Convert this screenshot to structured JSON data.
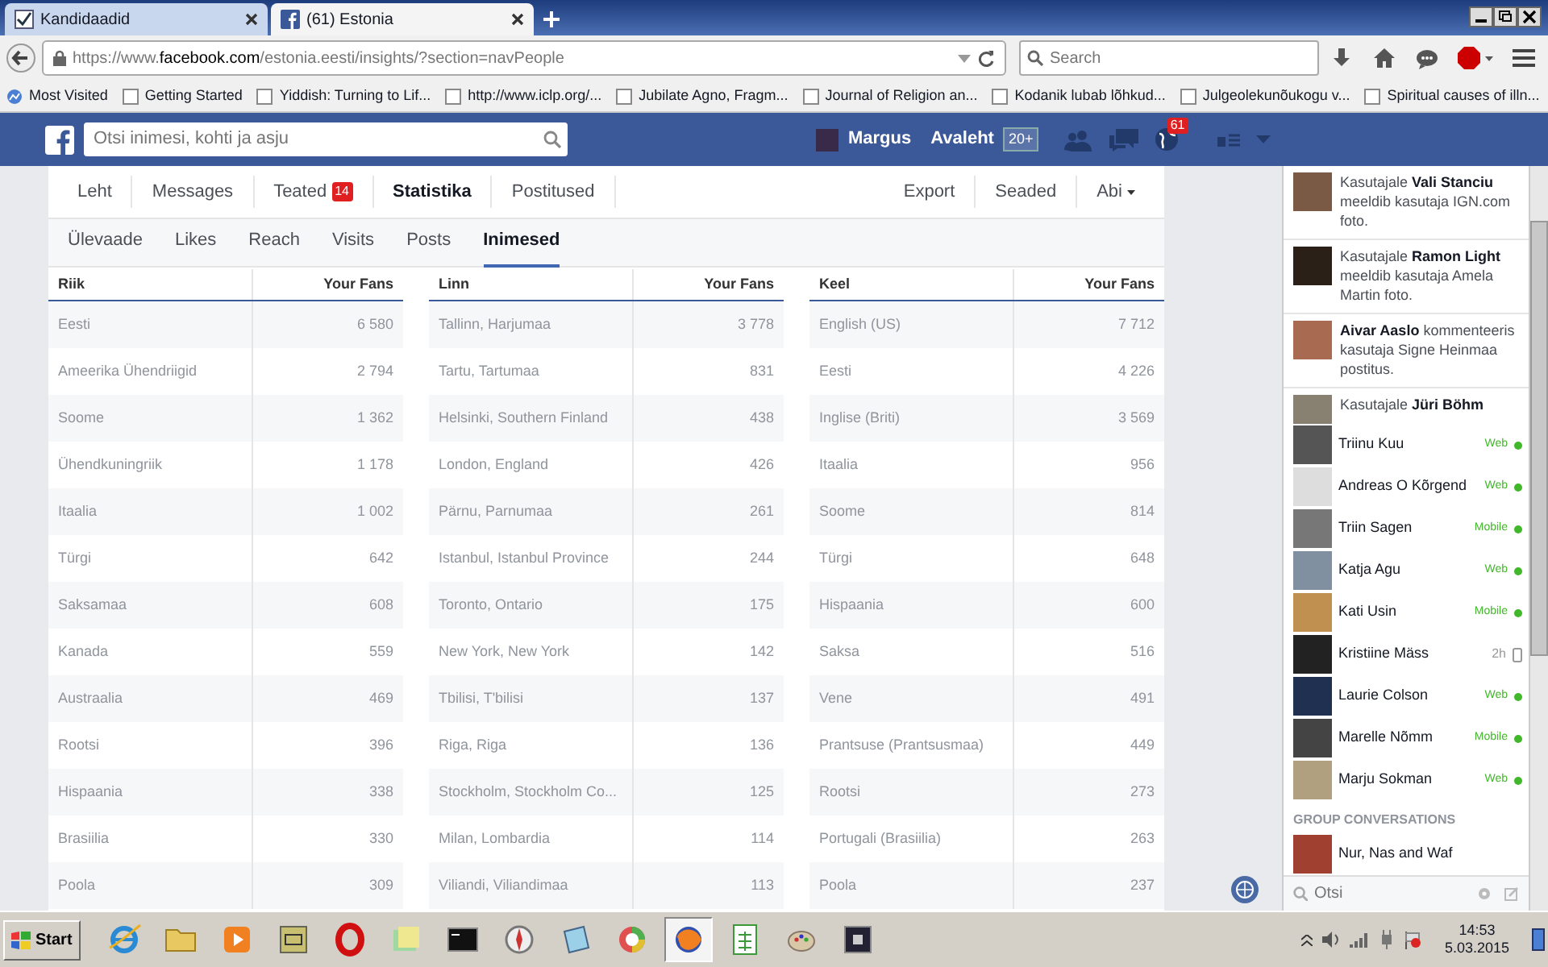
{
  "browser": {
    "tabs": [
      {
        "title": "Kandidaadid",
        "selected": false
      },
      {
        "title": "(61) Estonia",
        "selected": true
      }
    ],
    "url_host": "https://www.",
    "url_domain": "facebook.com",
    "url_path": "/estonia.eesti/insights/?section=navPeople",
    "search_placeholder": "Search",
    "bookmarks": [
      "Most Visited",
      "Getting Started",
      "Yiddish: Turning to Lif...",
      "http://www.iclp.org/...",
      "Jubilate Agno, Fragm...",
      "Journal of Religion an...",
      "Kodanik lubab lõhkud...",
      "Julgeolekunõukogu v...",
      "Spiritual causes of illn..."
    ]
  },
  "header": {
    "search_placeholder": "Otsi inimesi, kohti ja asju",
    "user": "Margus",
    "home": "Avaleht",
    "home_badge": "20+",
    "notifications_badge": "61"
  },
  "page_tabs": [
    {
      "label": "Leht",
      "selected": false
    },
    {
      "label": "Messages",
      "selected": false
    },
    {
      "label": "Teated",
      "badge": "14",
      "selected": false
    },
    {
      "label": "Statistika",
      "selected": true
    },
    {
      "label": "Postitused",
      "selected": false
    }
  ],
  "page_actions": [
    {
      "label": "Export",
      "kind": "plain"
    },
    {
      "label": "Seaded",
      "kind": "plain"
    },
    {
      "label": "Abi",
      "kind": "menu"
    }
  ],
  "sub_tabs": [
    {
      "label": "Ülevaade",
      "selected": false
    },
    {
      "label": "Likes",
      "selected": false
    },
    {
      "label": "Reach",
      "selected": false
    },
    {
      "label": "Visits",
      "selected": false
    },
    {
      "label": "Posts",
      "selected": false
    },
    {
      "label": "Inimesed",
      "selected": true
    }
  ],
  "tables": [
    {
      "columns": [
        "Riik",
        "Your Fans"
      ],
      "rows": [
        [
          "Eesti",
          "6 580"
        ],
        [
          "Ameerika Ühendriigid",
          "2 794"
        ],
        [
          "Soome",
          "1 362"
        ],
        [
          "Ühendkuningriik",
          "1 178"
        ],
        [
          "Itaalia",
          "1 002"
        ],
        [
          "Türgi",
          "642"
        ],
        [
          "Saksamaa",
          "608"
        ],
        [
          "Kanada",
          "559"
        ],
        [
          "Austraalia",
          "469"
        ],
        [
          "Rootsi",
          "396"
        ],
        [
          "Hispaania",
          "338"
        ],
        [
          "Brasiilia",
          "330"
        ],
        [
          "Poola",
          "309"
        ]
      ]
    },
    {
      "columns": [
        "Linn",
        "Your Fans"
      ],
      "rows": [
        [
          "Tallinn, Harjumaa",
          "3 778"
        ],
        [
          "Tartu, Tartumaa",
          "831"
        ],
        [
          "Helsinki, Southern Finland",
          "438"
        ],
        [
          "London, England",
          "426"
        ],
        [
          "Pärnu, Parnumaa",
          "261"
        ],
        [
          "Istanbul, Istanbul Province",
          "244"
        ],
        [
          "Toronto, Ontario",
          "175"
        ],
        [
          "New York, New York",
          "142"
        ],
        [
          "Tbilisi, T'bilisi",
          "137"
        ],
        [
          "Riga, Riga",
          "136"
        ],
        [
          "Stockholm, Stockholm Co...",
          "125"
        ],
        [
          "Milan, Lombardia",
          "114"
        ],
        [
          "Viliandi, Viliandimaa",
          "113"
        ]
      ]
    },
    {
      "columns": [
        "Keel",
        "Your Fans"
      ],
      "rows": [
        [
          "English (US)",
          "7 712"
        ],
        [
          "Eesti",
          "4 226"
        ],
        [
          "Inglise (Briti)",
          "3 569"
        ],
        [
          "Itaalia",
          "956"
        ],
        [
          "Soome",
          "814"
        ],
        [
          "Türgi",
          "648"
        ],
        [
          "Hispaania",
          "600"
        ],
        [
          "Saksa",
          "516"
        ],
        [
          "Vene",
          "491"
        ],
        [
          "Prantsuse (Prantsusmaa)",
          "449"
        ],
        [
          "Rootsi",
          "273"
        ],
        [
          "Portugali (Brasiilia)",
          "263"
        ],
        [
          "Poola",
          "237"
        ]
      ]
    }
  ],
  "ticker": [
    "Kasutajale **Vali Stanciu** meeldib kasutaja IGN.com foto.",
    "Kasutajale **Ramon Light** meeldib kasutaja Amela Martin foto.",
    "**Aivar Aaslo** kommenteeris kasutaja Signe Heinmaa postitus.",
    "Kasutajale **Jüri Böhm**"
  ],
  "chat": [
    {
      "name": "Triinu Kuu",
      "status": "Web",
      "kind": "online",
      "color": "#42b72a"
    },
    {
      "name": "Andreas O Kõrgend",
      "status": "Web",
      "kind": "online",
      "color": "#42b72a"
    },
    {
      "name": "Triin Sagen",
      "status": "Mobile",
      "kind": "online",
      "color": "#42b72a"
    },
    {
      "name": "Katja Agu",
      "status": "Web",
      "kind": "online",
      "color": "#42b72a"
    },
    {
      "name": "Kati Usin",
      "status": "Mobile",
      "kind": "online",
      "color": "#42b72a"
    },
    {
      "name": "Kristiine Mäss",
      "status": "2h",
      "kind": "idle"
    },
    {
      "name": "Laurie Colson",
      "status": "Web",
      "kind": "online",
      "color": "#42b72a"
    },
    {
      "name": "Marelle Nõmm",
      "status": "Mobile",
      "kind": "online",
      "color": "#42b72a"
    },
    {
      "name": "Marju Sokman",
      "status": "Web",
      "kind": "online",
      "color": "#42b72a"
    }
  ],
  "group_heading": "GROUP CONVERSATIONS",
  "groups": [
    "Nur, Nas and Waf"
  ],
  "chat_search_placeholder": "Otsi",
  "taskbar": {
    "start": "Start",
    "apps": [
      {
        "selected": false
      },
      {
        "selected": false
      },
      {
        "selected": false
      },
      {
        "selected": false
      },
      {
        "selected": false
      },
      {
        "selected": false
      },
      {
        "selected": false
      },
      {
        "selected": false
      },
      {
        "selected": false
      },
      {
        "selected": false
      },
      {
        "selected": true
      },
      {
        "selected": false
      },
      {
        "selected": false
      },
      {
        "selected": false
      }
    ],
    "time": "14:53",
    "date": "5.03.2015"
  }
}
